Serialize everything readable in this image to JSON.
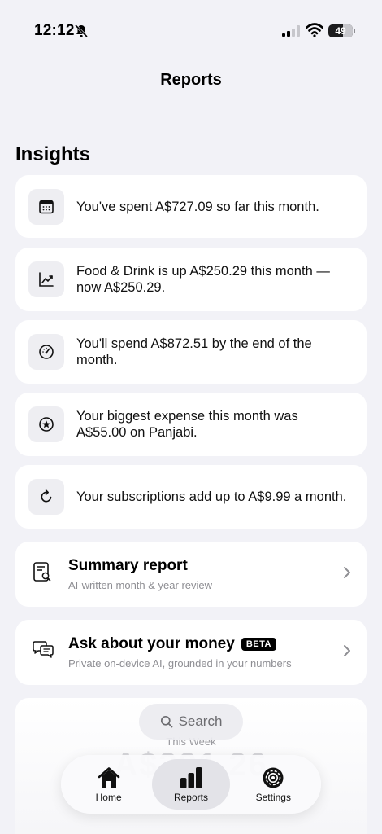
{
  "status_bar": {
    "time": "12:12",
    "battery": "49"
  },
  "nav": {
    "title": "Reports"
  },
  "insights": {
    "title": "Insights",
    "items": [
      {
        "icon": "calendar-icon",
        "text": "You've spent A$727.09 so far this month."
      },
      {
        "icon": "trend-up-icon",
        "text": "Food & Drink is up A$250.29 this month — now A$250.29."
      },
      {
        "icon": "gauge-icon",
        "text": "You'll spend A$872.51 by the end of the month."
      },
      {
        "icon": "star-circle-icon",
        "text": "Your biggest expense this month was A$55.00 on Panjabi."
      },
      {
        "icon": "refresh-icon",
        "text": "Your subscriptions add up to A$9.99 a month."
      }
    ]
  },
  "summary_report": {
    "title": "Summary report",
    "subtitle": "AI-written month & year review"
  },
  "ask_money": {
    "title": "Ask about your money",
    "badge": "BETA",
    "subtitle": "Private on-device AI, grounded in your numbers"
  },
  "week_card": {
    "label": "This Week",
    "amount": "A$331.26"
  },
  "search": {
    "label": "Search"
  },
  "tabs": [
    {
      "label": "Home",
      "active": false
    },
    {
      "label": "Reports",
      "active": true
    },
    {
      "label": "Settings",
      "active": false
    }
  ]
}
